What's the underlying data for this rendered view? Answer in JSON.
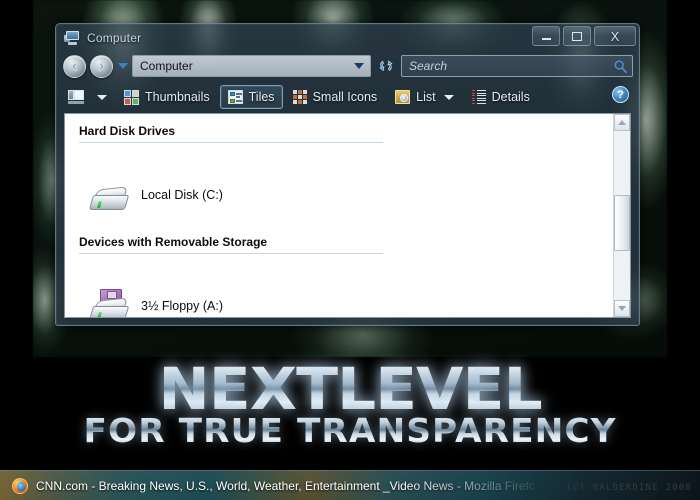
{
  "desktop": {
    "wallpaper_description": "dark-green-abstract"
  },
  "window": {
    "title": "Computer",
    "title_icon": "computer-icon",
    "controls": {
      "minimize": "minimize-button",
      "maximize": "maximize-button",
      "close_label": "X"
    },
    "navigation": {
      "back": "back-button",
      "forward": "forward-button",
      "history_dropdown": "chevron-down-icon"
    },
    "address": {
      "value": "Computer",
      "dropdown_icon": "chevron-down-icon",
      "refresh_icon": "refresh-icon"
    },
    "search": {
      "placeholder": "Search",
      "icon": "search-icon"
    },
    "toolbar": {
      "layout_button": "layout-pane-icon",
      "layout_caret": "chevron-down-icon",
      "help_label": "?",
      "views": [
        {
          "label": "Thumbnails",
          "icon": "thumbnails-icon",
          "selected": false,
          "caret": false
        },
        {
          "label": "Tiles",
          "icon": "tiles-icon",
          "selected": true,
          "caret": false
        },
        {
          "label": "Small Icons",
          "icon": "small-icons-icon",
          "selected": false,
          "caret": false
        },
        {
          "label": "List",
          "icon": "list-icon",
          "selected": false,
          "caret": true
        },
        {
          "label": "Details",
          "icon": "details-icon",
          "selected": false,
          "caret": false
        }
      ]
    },
    "content": {
      "groups": [
        {
          "header": "Hard Disk Drives",
          "items": [
            {
              "label": "Local Disk (C:)",
              "icon": "hard-drive-icon"
            }
          ]
        },
        {
          "header": "Devices with Removable Storage",
          "items": [
            {
              "label": "3½ Floppy (A:)",
              "icon": "floppy-drive-icon"
            }
          ]
        }
      ]
    },
    "scrollbar": {
      "up_arrow": "scroll-up-icon",
      "down_arrow": "scroll-down-icon"
    }
  },
  "branding": {
    "title": "NEXTLEVEL",
    "subtitle": "FOR TRUE TRANSPARENCY"
  },
  "taskbar": {
    "task_button": {
      "icon": "firefox-icon",
      "label": "CNN.com - Breaking News, U.S., World, Weather, Entertainment _Video News - Mozilla Firefox"
    }
  },
  "copyright": "(C) BALDERDINE 2008",
  "colors": {
    "glass": "#2e3e4c",
    "accent_blue": "#3f7fbd",
    "floppy_purple": "#9f6ab4",
    "led_green": "#15a52c"
  }
}
